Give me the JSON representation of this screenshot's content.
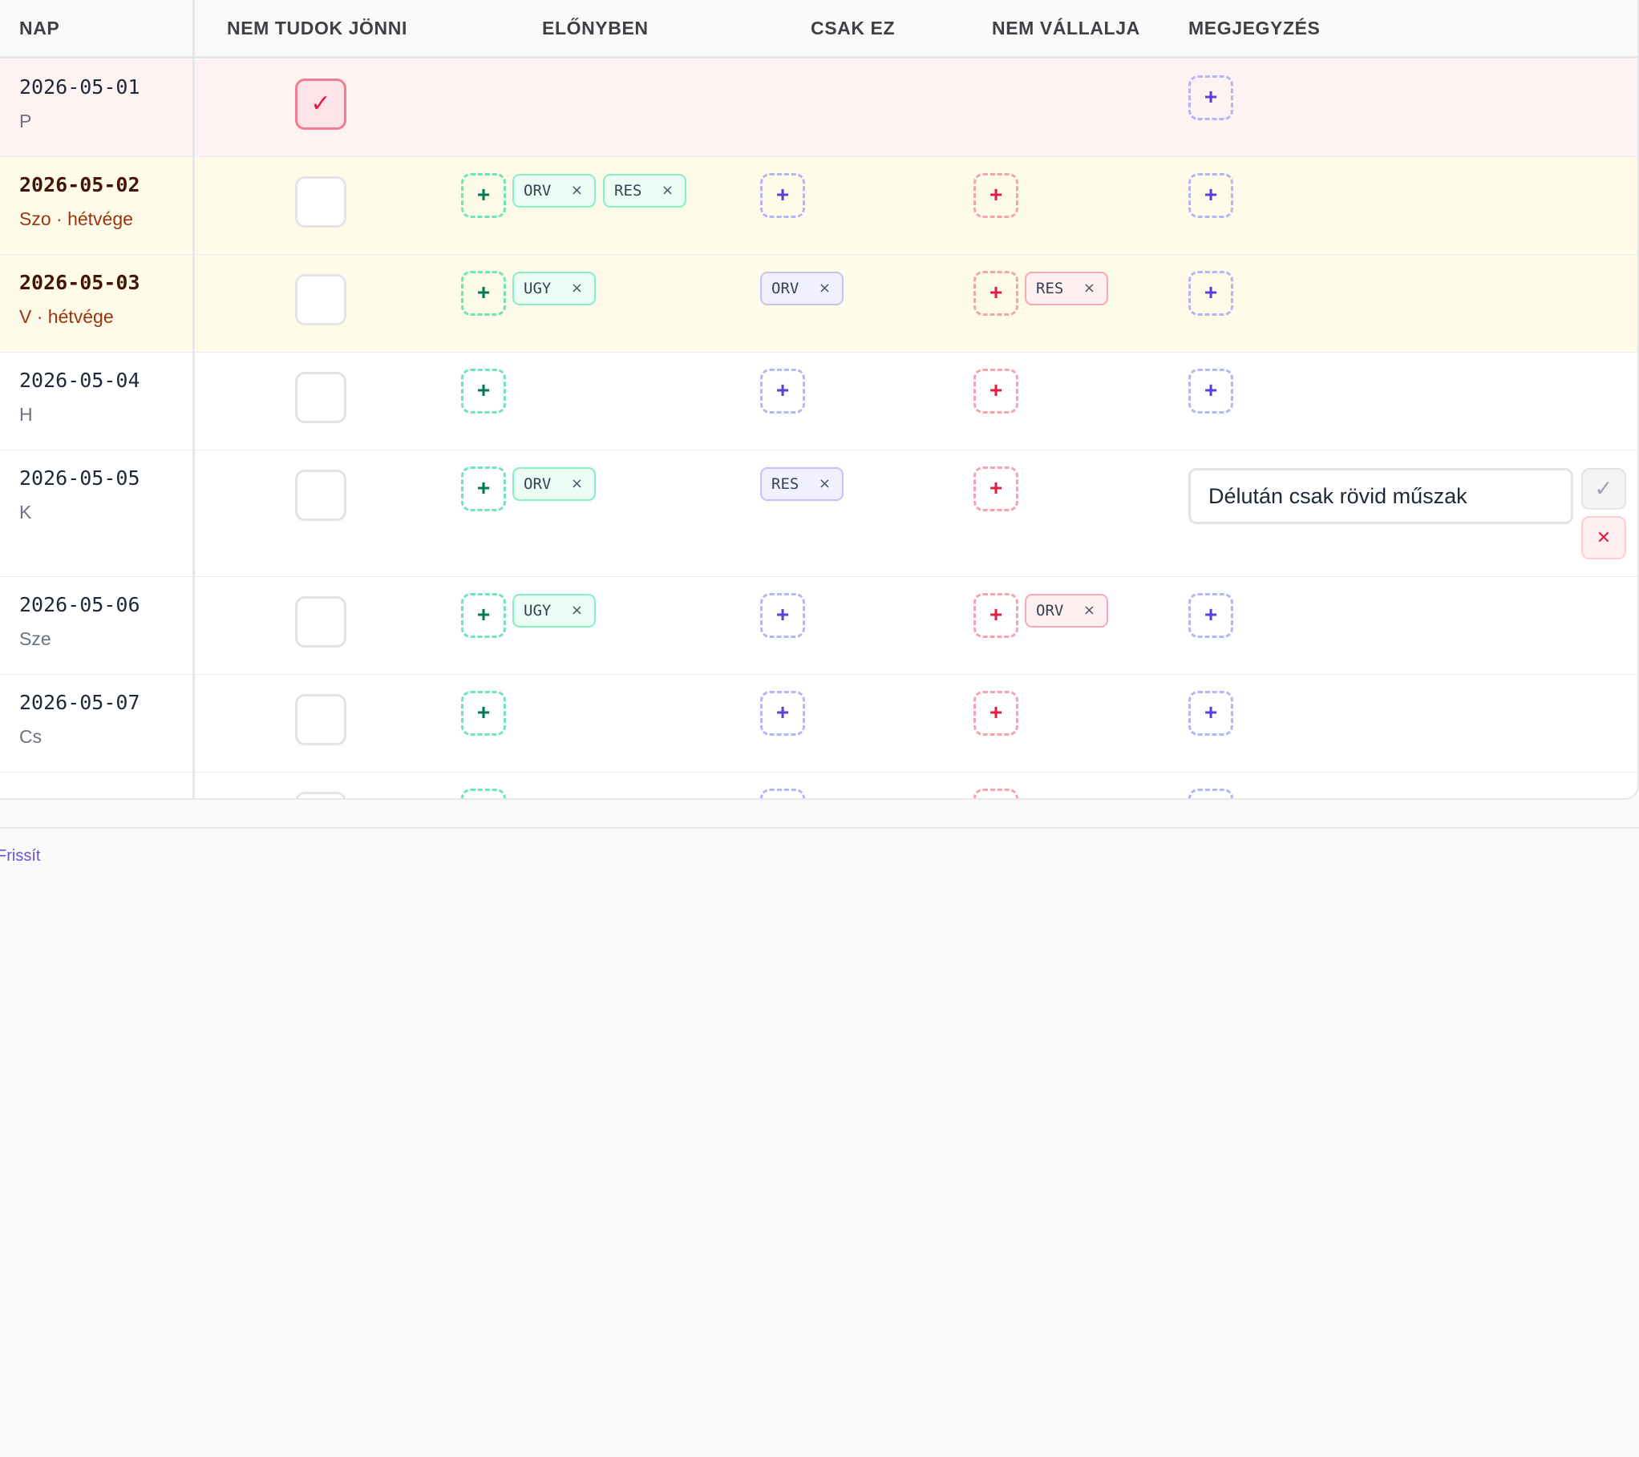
{
  "columns": {
    "nap": "NAP",
    "nem_tudok_jonni": "NEM TUDOK JÖNNI",
    "elonyben": "ELŐNYBEN",
    "csak_ez": "CSAK EZ",
    "nem_vallalja": "NEM VÁLLALJA",
    "megjegyzes": "MEGJEGYZÉS"
  },
  "icons": {
    "add": "+",
    "check": "✓",
    "remove": "×",
    "cancel": "✕"
  },
  "rows": [
    {
      "date": "2026-05-01",
      "day": "P",
      "unavailable": true
    },
    {
      "date": "2026-05-02",
      "day": "Szo · hétvége",
      "weekend": true,
      "preferred": [
        "ORV",
        "RES"
      ]
    },
    {
      "date": "2026-05-03",
      "day": "V · hétvége",
      "weekend": true,
      "preferred": [
        "UGY"
      ],
      "only": [
        "ORV"
      ],
      "refuses": [
        "RES"
      ]
    },
    {
      "date": "2026-05-04",
      "day": "H"
    },
    {
      "date": "2026-05-05",
      "day": "K",
      "preferred": [
        "ORV"
      ],
      "only": [
        "RES"
      ],
      "note_value": "Délután csak rövid műszak"
    },
    {
      "date": "2026-05-06",
      "day": "Sze",
      "preferred": [
        "UGY"
      ],
      "refuses": [
        "ORV"
      ]
    },
    {
      "date": "2026-05-07",
      "day": "Cs"
    }
  ],
  "footer": {
    "refresh_label": "Frissít"
  },
  "colors": {
    "accent": "#5b3fd6",
    "green": "#047857",
    "red": "#e11d48",
    "weekend_bg": "#fefce8",
    "unavailable_bg": "#fef2f2"
  }
}
